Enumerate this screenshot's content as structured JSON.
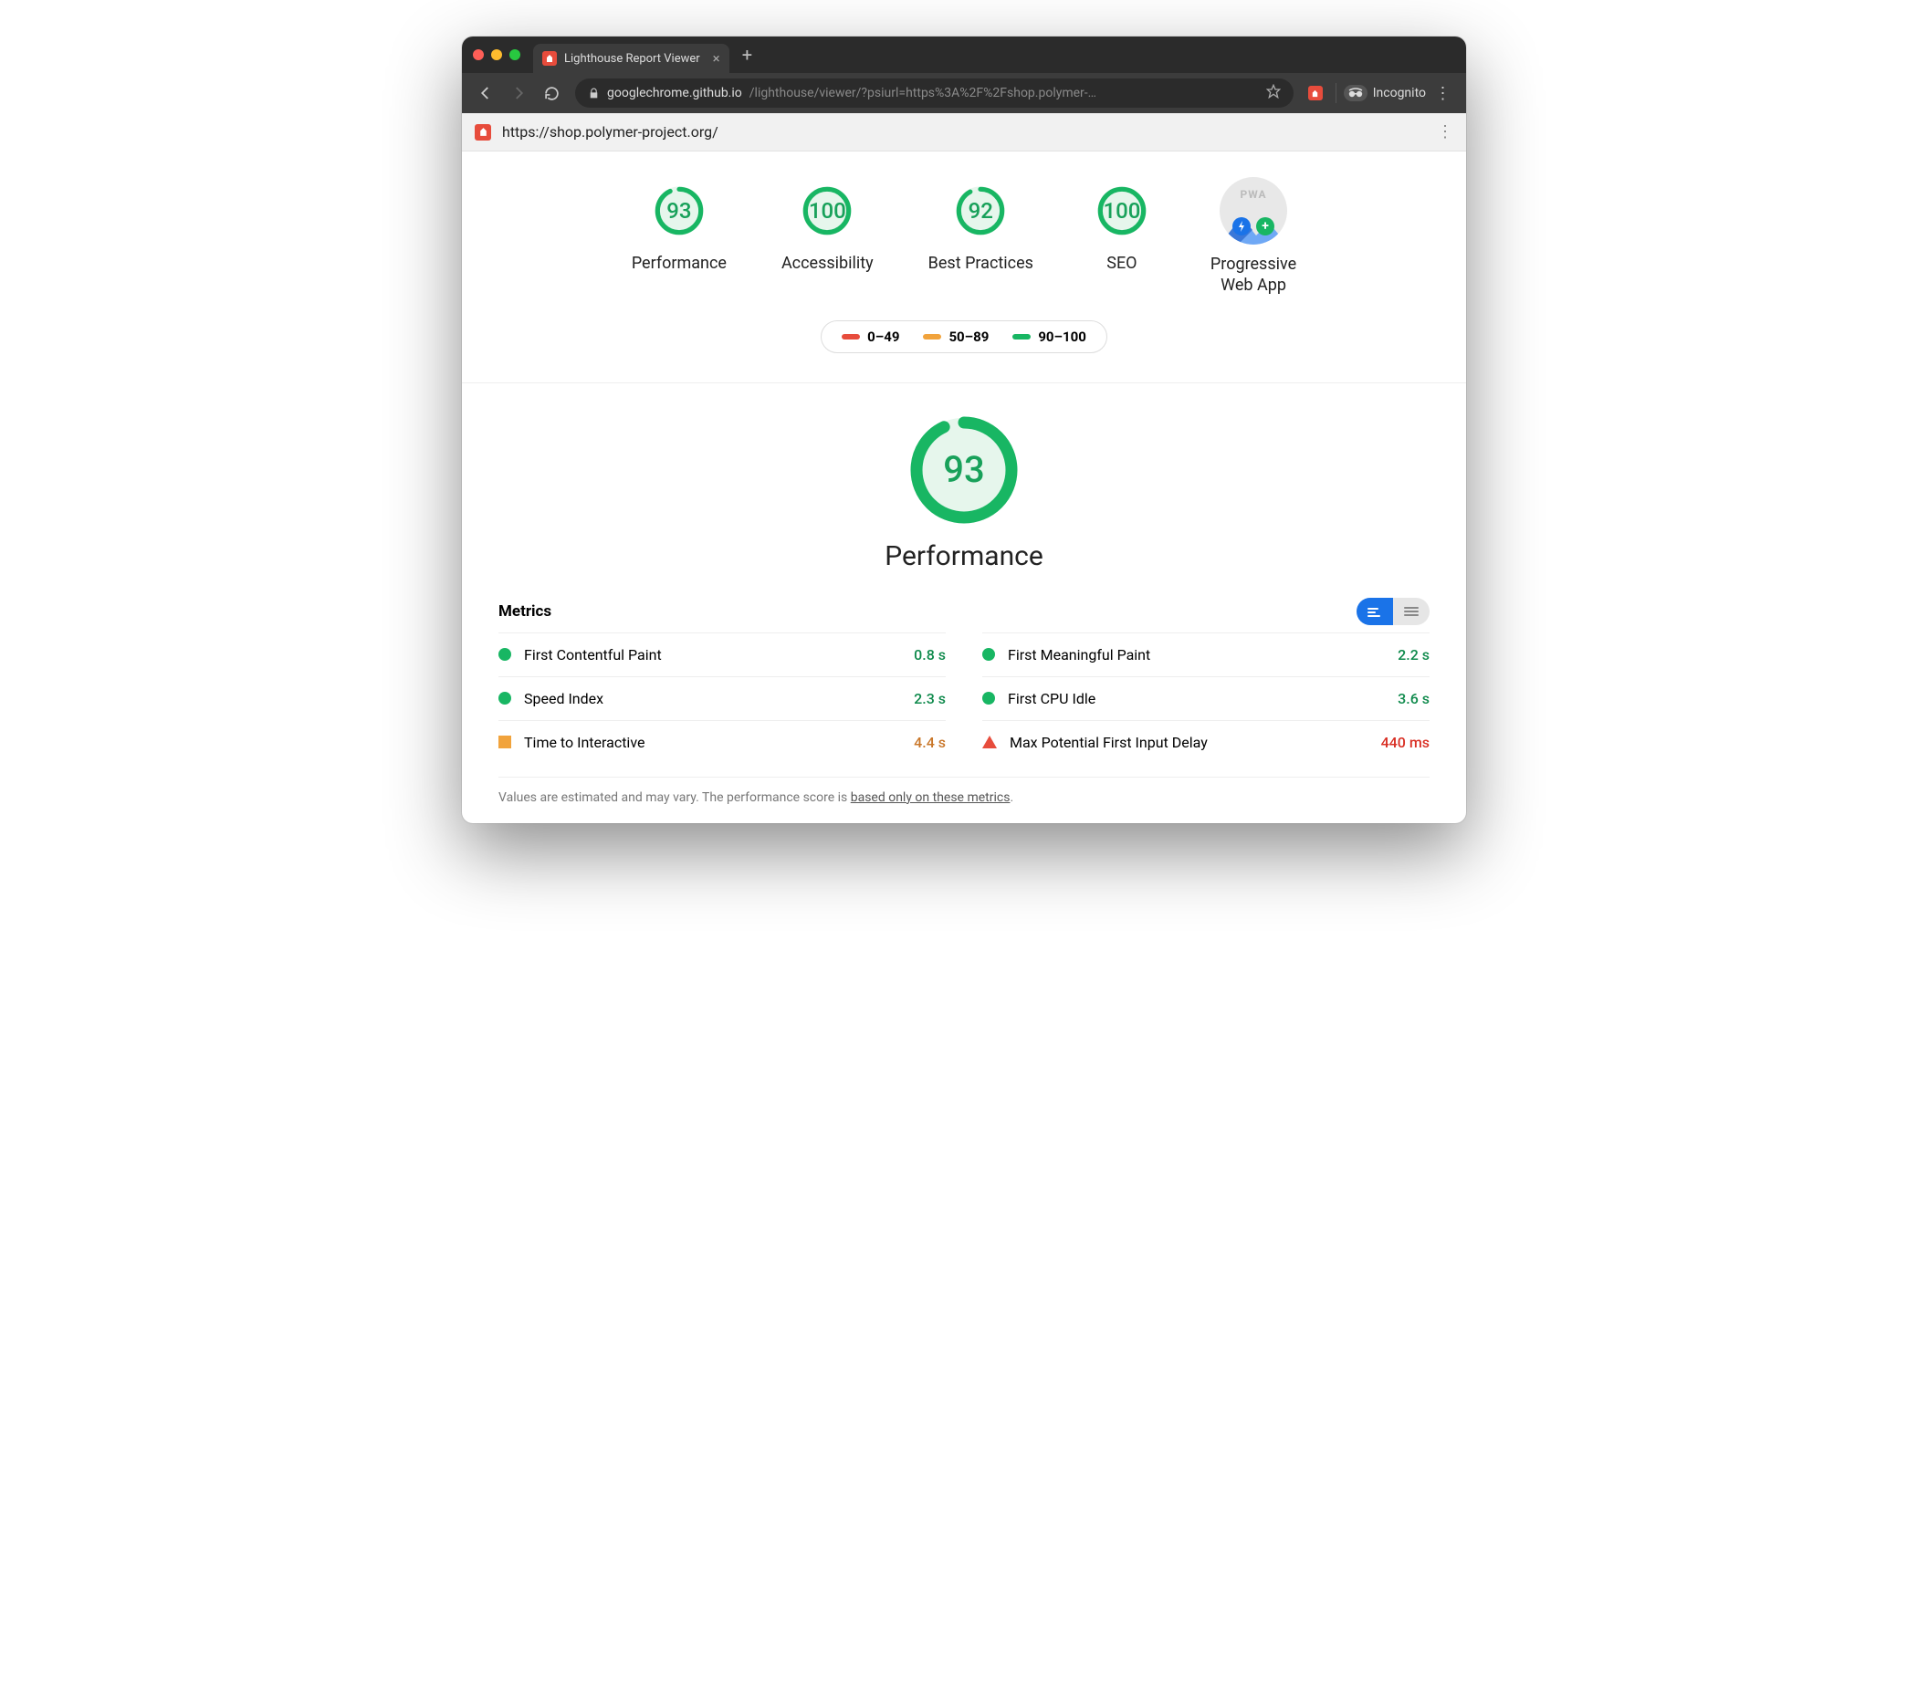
{
  "browser": {
    "tab_title": "Lighthouse Report Viewer",
    "url_host": "googlechrome.github.io",
    "url_path": "/lighthouse/viewer/?psiurl=https%3A%2F%2Fshop.polymer-…",
    "incognito_label": "Incognito"
  },
  "report": {
    "target_url": "https://shop.polymer-project.org/",
    "scores": [
      {
        "label": "Performance",
        "value": 93
      },
      {
        "label": "Accessibility",
        "value": 100
      },
      {
        "label": "Best Practices",
        "value": 92
      },
      {
        "label": "SEO",
        "value": 100
      }
    ],
    "pwa_label": "Progressive Web App",
    "pwa_badge_text": "PWA",
    "legend": {
      "fail": "0–49",
      "avg": "50–89",
      "pass": "90–100"
    }
  },
  "category": {
    "name": "Performance",
    "score": 93,
    "metrics_heading": "Metrics",
    "metrics_left": [
      {
        "name": "First Contentful Paint",
        "value": "0.8 s",
        "status": "pass"
      },
      {
        "name": "Speed Index",
        "value": "2.3 s",
        "status": "pass"
      },
      {
        "name": "Time to Interactive",
        "value": "4.4 s",
        "status": "avg"
      }
    ],
    "metrics_right": [
      {
        "name": "First Meaningful Paint",
        "value": "2.2 s",
        "status": "pass"
      },
      {
        "name": "First CPU Idle",
        "value": "3.6 s",
        "status": "pass"
      },
      {
        "name": "Max Potential First Input Delay",
        "value": "440 ms",
        "status": "fail"
      }
    ],
    "footnote_prefix": "Values are estimated and may vary. The performance score is ",
    "footnote_link": "based only on these metrics",
    "footnote_suffix": "."
  },
  "chart_data": {
    "type": "bar",
    "title": "Lighthouse category scores",
    "categories": [
      "Performance",
      "Accessibility",
      "Best Practices",
      "SEO"
    ],
    "values": [
      93,
      100,
      92,
      100
    ],
    "ylim": [
      0,
      100
    ],
    "thresholds": {
      "fail": "0–49",
      "average": "50–89",
      "pass": "90–100"
    }
  }
}
